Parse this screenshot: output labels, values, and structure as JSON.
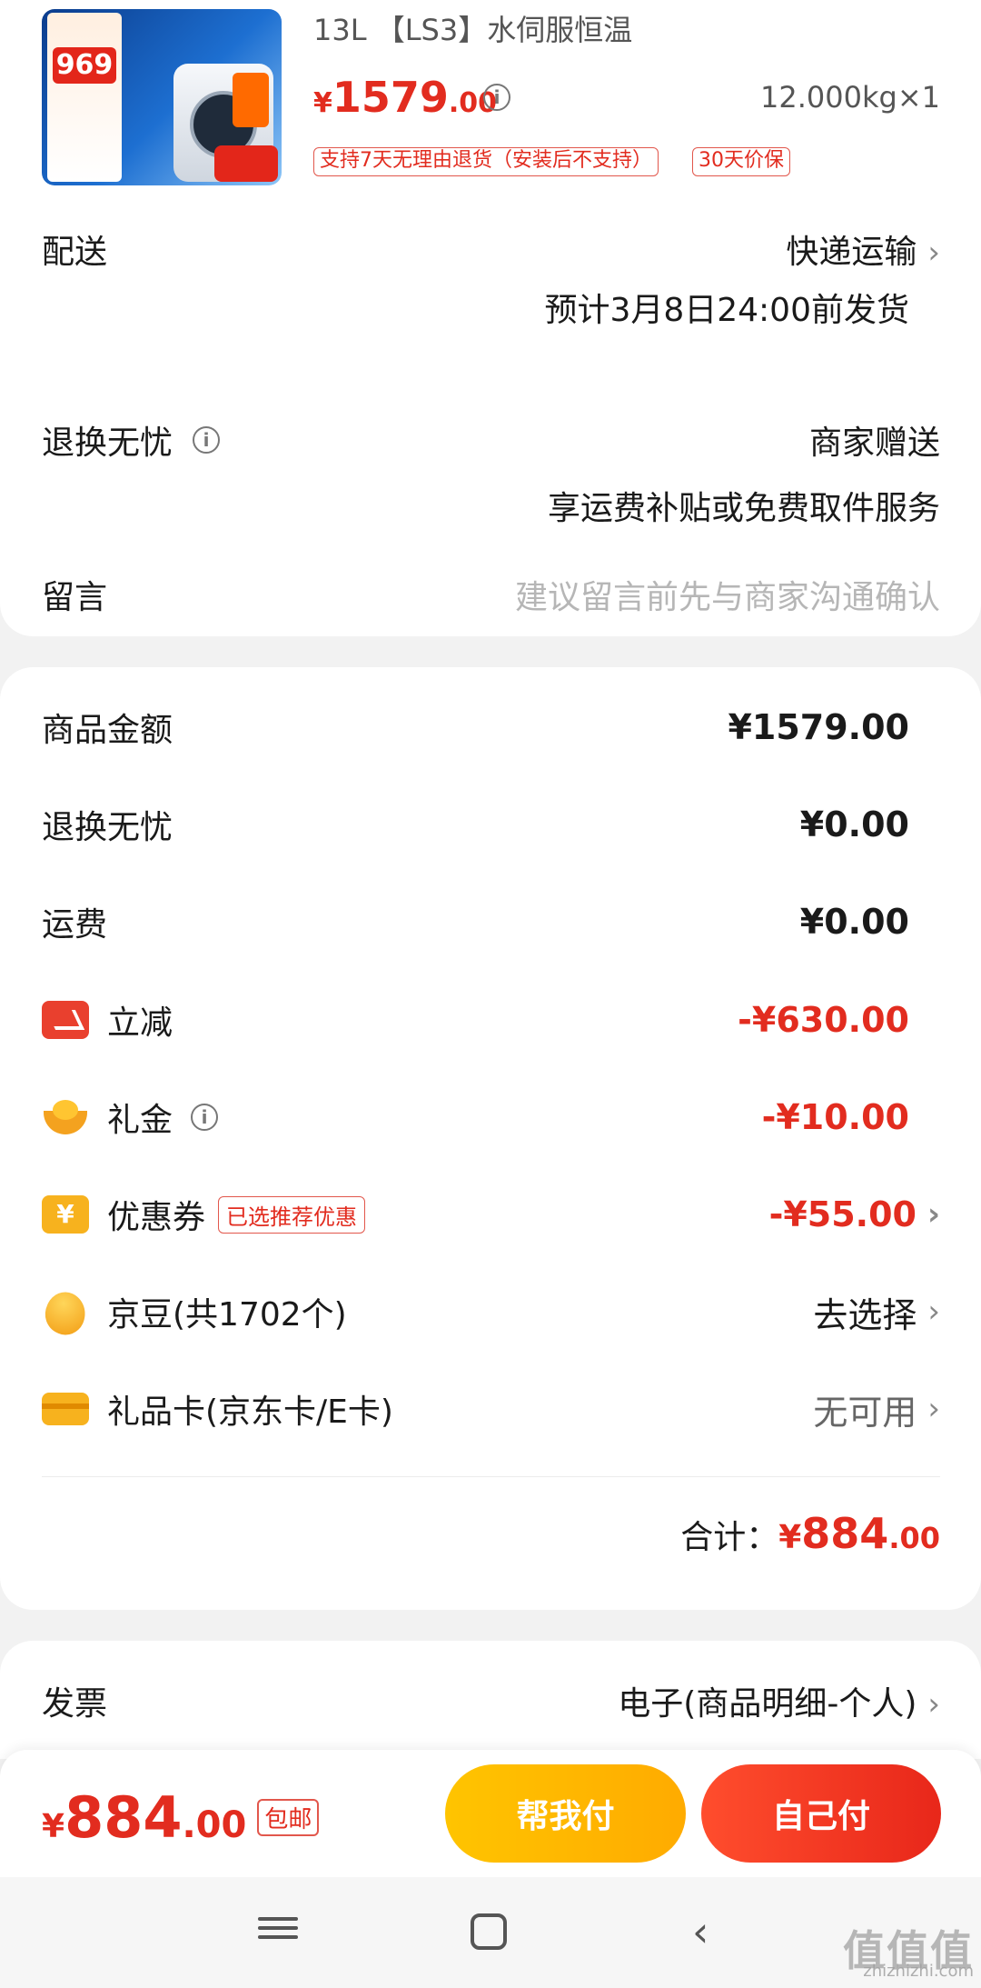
{
  "product": {
    "title": "13L 【LS3】水伺服恒温",
    "price_currency": "¥",
    "price_int": "1579",
    "price_dec": ".00",
    "quantity": "12.000kg×1",
    "tags": [
      "支持7天无理由退货（安装后不支持）",
      "30天价保"
    ],
    "thumbnail_text": "969"
  },
  "delivery": {
    "label": "配送",
    "method": "快递运输",
    "eta": "预计3月8日24:00前发货"
  },
  "returns": {
    "label": "退换无忧",
    "value": "商家赠送",
    "desc": "享运费补贴或免费取件服务"
  },
  "message": {
    "label": "留言",
    "placeholder": "建议留言前先与商家沟通确认"
  },
  "amounts": [
    {
      "label": "商品金额",
      "value": "¥1579.00"
    },
    {
      "label": "退换无忧",
      "value": "¥0.00"
    },
    {
      "label": "运费",
      "value": "¥0.00"
    },
    {
      "label": "立减",
      "value": "-¥630.00"
    },
    {
      "label": "礼金",
      "value": "-¥10.00"
    },
    {
      "label": "优惠券",
      "value": "-¥55.00",
      "tag": "已选推荐优惠"
    },
    {
      "label": "京豆(共1702个)",
      "value": "去选择"
    },
    {
      "label": "礼品卡(京东卡/E卡)",
      "value": "无可用"
    }
  ],
  "total": {
    "label": "合计：",
    "currency": "¥",
    "int": "884",
    "dec": ".00"
  },
  "invoice": {
    "label": "发票",
    "value": "电子(商品明细-个人)"
  },
  "paybar": {
    "currency": "¥",
    "int": "884",
    "dec": ".00",
    "free_shipping": "包邮",
    "help_pay": "帮我付",
    "self_pay": "自己付"
  },
  "watermark": {
    "main": "值值值",
    "sub": "zhizhizhi.com"
  },
  "colors": {
    "accent_red": "#e22c1f",
    "help_yellow": "#ffb800",
    "self_red": "#ed3522"
  }
}
